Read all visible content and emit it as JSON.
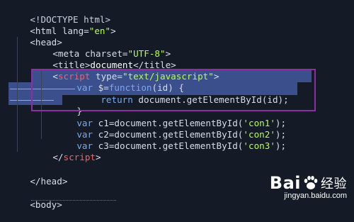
{
  "colors": {
    "background": "#151b26",
    "default_text": "#d8dee9",
    "string": "#b5ff45",
    "tag": "#ff5d5d",
    "keyword": "#7aa7f0",
    "doctype": "#c8d0de",
    "selection": "#3b4f8c",
    "annotation_box": "#8e2fa1"
  },
  "code": {
    "l1": {
      "t": "<!DOCTYPE html>"
    },
    "l2": {
      "a": "<html lang=",
      "b": "\"en\"",
      "c": ">"
    },
    "l3": {
      "t": "<head>"
    },
    "l4": {
      "a": "<meta charset=",
      "b": "\"UTF-8\"",
      "c": ">"
    },
    "l5": {
      "a": "<title>",
      "b": "document",
      "c": "</title>"
    },
    "l6": {
      "a": "<",
      "b": "script",
      "c": " type=",
      "d": "\"text/javascript\"",
      "e": ">"
    },
    "l7": {
      "a": "var",
      "b": " $=",
      "c": "function",
      "d": "(id) {"
    },
    "l8": {
      "a": "return",
      "b": " document.getElementById(id);"
    },
    "l9": {
      "t": "}"
    },
    "l10": {
      "a": "var",
      "b": " c1=document.getElementById(",
      "c": "'con1'",
      "d": ");"
    },
    "l11": {
      "a": "var",
      "b": " c2=document.getElementById(",
      "c": "'con2'",
      "d": ");"
    },
    "l12": {
      "a": "var",
      "b": " c3=document.getElementById(",
      "c": "'con3'",
      "d": ");"
    },
    "l13": {
      "a": "</",
      "b": "script",
      "c": ">"
    },
    "l15": {
      "t": "</head>"
    },
    "l17": {
      "t": "<body>"
    }
  },
  "watermark": {
    "brand_prefix": "Bai",
    "brand_icon": "paw-icon",
    "brand_suffix": "经验",
    "url": "jingyan.baidu.com"
  }
}
